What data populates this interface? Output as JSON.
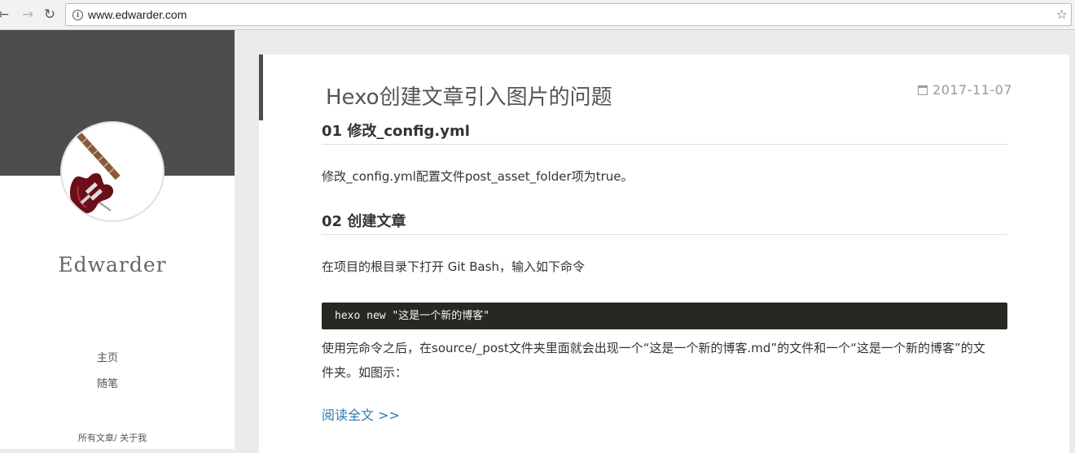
{
  "browser": {
    "url": "www.edwarder.com",
    "back_icon": "←",
    "forward_icon": "→",
    "reload_icon": "↻",
    "info_icon": "i",
    "star_icon": "☆"
  },
  "sidebar": {
    "blog_name": "Edwarder",
    "nav": {
      "home": "主页",
      "notes": "随笔"
    },
    "footer": {
      "all_posts": "所有文章",
      "separator": "/ ",
      "about": "关于我"
    },
    "avatar_alt": "electric-guitar-avatar"
  },
  "post": {
    "title": "Hexo创建文章引入图片的问题",
    "date": "2017-11-07",
    "sections": [
      {
        "heading": "01 修改_config.yml"
      },
      {
        "heading": "02 创建文章"
      }
    ],
    "para1": "修改_config.yml配置文件post_asset_folder项为true。",
    "para2": "在项目的根目录下打开 Git Bash，输入如下命令",
    "code": "hexo new \"这是一个新的博客\"",
    "para3": "使用完命令之后，在source/_post文件夹里面就会出现一个“这是一个新的博客.md”的文件和一个“这是一个新的博客”的文件夹。如图示：",
    "read_more": "阅读全文 >>"
  },
  "colors": {
    "sidebar_band": "#4d4d4d",
    "link": "#2a7ab0",
    "code_bg": "#272822"
  }
}
